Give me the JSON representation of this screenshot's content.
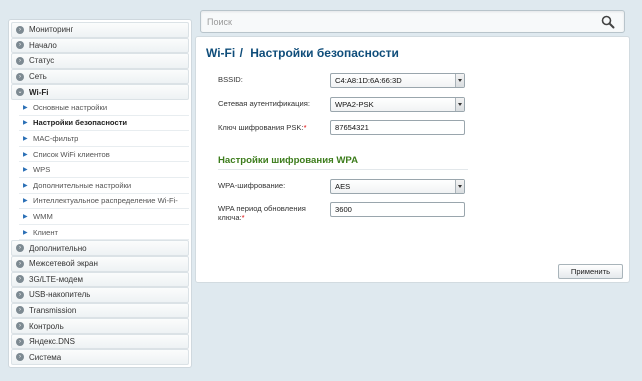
{
  "search": {
    "placeholder": "Поиск"
  },
  "sidebar": {
    "items": [
      {
        "label": "Мониторинг"
      },
      {
        "label": "Начало"
      },
      {
        "label": "Статус"
      },
      {
        "label": "Сеть"
      },
      {
        "label": "Wi-Fi"
      },
      {
        "label": "Дополнительно"
      },
      {
        "label": "Межсетевой экран"
      },
      {
        "label": "3G/LTE-модем"
      },
      {
        "label": "USB-накопитель"
      },
      {
        "label": "Transmission"
      },
      {
        "label": "Контроль"
      },
      {
        "label": "Яндекс.DNS"
      },
      {
        "label": "Система"
      }
    ],
    "wifi_sub": [
      {
        "label": "Основные настройки"
      },
      {
        "label": "Настройки безопасности"
      },
      {
        "label": "MAC-фильтр"
      },
      {
        "label": "Список WiFi клиентов"
      },
      {
        "label": "WPS"
      },
      {
        "label": "Дополнительные настройки"
      },
      {
        "label": "Интеллектуальное распределение Wi-Fi-"
      },
      {
        "label": "WMM"
      },
      {
        "label": "Клиент"
      }
    ]
  },
  "main": {
    "title_section": "Wi-Fi",
    "title_separator": "/",
    "title_page": "Настройки безопасности",
    "bssid_label": "BSSID:",
    "bssid_value": "C4:A8:1D:6A:66:3D",
    "auth_label": "Сетевая аутентификация:",
    "auth_value": "WPA2-PSK",
    "psk_label": "Ключ шифрования PSK:",
    "psk_required": "*",
    "psk_value": "87654321",
    "wpa_section": "Настройки шифрования WPA",
    "wpa_enc_label": "WPA-шифрование:",
    "wpa_enc_value": "AES",
    "wpa_period_label_1": "WPA период обновления",
    "wpa_period_label_2": "ключа:",
    "wpa_period_required": "*",
    "wpa_period_value": "3600",
    "apply_label": "Применить"
  }
}
